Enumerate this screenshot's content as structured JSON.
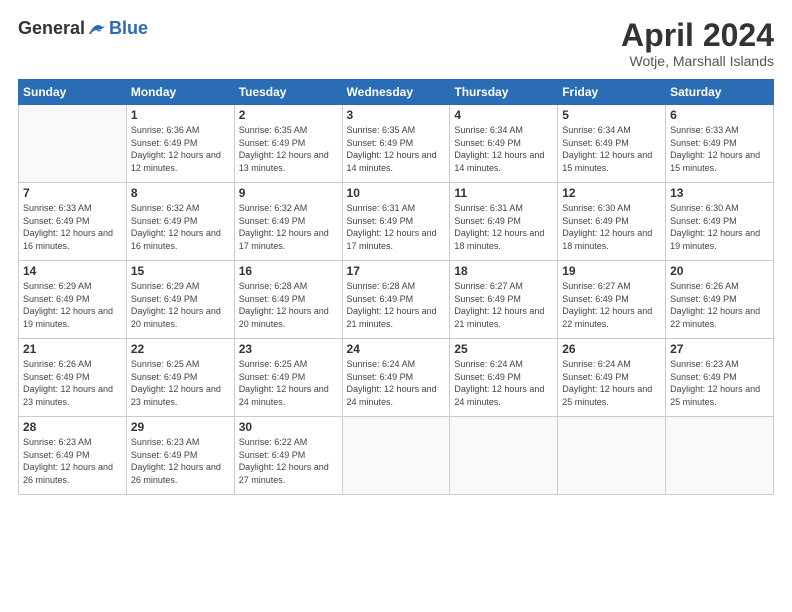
{
  "logo": {
    "general": "General",
    "blue": "Blue"
  },
  "title": "April 2024",
  "subtitle": "Wotje, Marshall Islands",
  "days_of_week": [
    "Sunday",
    "Monday",
    "Tuesday",
    "Wednesday",
    "Thursday",
    "Friday",
    "Saturday"
  ],
  "weeks": [
    [
      {
        "day": "",
        "sunrise": "",
        "sunset": "",
        "daylight": ""
      },
      {
        "day": "1",
        "sunrise": "Sunrise: 6:36 AM",
        "sunset": "Sunset: 6:49 PM",
        "daylight": "Daylight: 12 hours and 12 minutes."
      },
      {
        "day": "2",
        "sunrise": "Sunrise: 6:35 AM",
        "sunset": "Sunset: 6:49 PM",
        "daylight": "Daylight: 12 hours and 13 minutes."
      },
      {
        "day": "3",
        "sunrise": "Sunrise: 6:35 AM",
        "sunset": "Sunset: 6:49 PM",
        "daylight": "Daylight: 12 hours and 14 minutes."
      },
      {
        "day": "4",
        "sunrise": "Sunrise: 6:34 AM",
        "sunset": "Sunset: 6:49 PM",
        "daylight": "Daylight: 12 hours and 14 minutes."
      },
      {
        "day": "5",
        "sunrise": "Sunrise: 6:34 AM",
        "sunset": "Sunset: 6:49 PM",
        "daylight": "Daylight: 12 hours and 15 minutes."
      },
      {
        "day": "6",
        "sunrise": "Sunrise: 6:33 AM",
        "sunset": "Sunset: 6:49 PM",
        "daylight": "Daylight: 12 hours and 15 minutes."
      }
    ],
    [
      {
        "day": "7",
        "sunrise": "Sunrise: 6:33 AM",
        "sunset": "Sunset: 6:49 PM",
        "daylight": "Daylight: 12 hours and 16 minutes."
      },
      {
        "day": "8",
        "sunrise": "Sunrise: 6:32 AM",
        "sunset": "Sunset: 6:49 PM",
        "daylight": "Daylight: 12 hours and 16 minutes."
      },
      {
        "day": "9",
        "sunrise": "Sunrise: 6:32 AM",
        "sunset": "Sunset: 6:49 PM",
        "daylight": "Daylight: 12 hours and 17 minutes."
      },
      {
        "day": "10",
        "sunrise": "Sunrise: 6:31 AM",
        "sunset": "Sunset: 6:49 PM",
        "daylight": "Daylight: 12 hours and 17 minutes."
      },
      {
        "day": "11",
        "sunrise": "Sunrise: 6:31 AM",
        "sunset": "Sunset: 6:49 PM",
        "daylight": "Daylight: 12 hours and 18 minutes."
      },
      {
        "day": "12",
        "sunrise": "Sunrise: 6:30 AM",
        "sunset": "Sunset: 6:49 PM",
        "daylight": "Daylight: 12 hours and 18 minutes."
      },
      {
        "day": "13",
        "sunrise": "Sunrise: 6:30 AM",
        "sunset": "Sunset: 6:49 PM",
        "daylight": "Daylight: 12 hours and 19 minutes."
      }
    ],
    [
      {
        "day": "14",
        "sunrise": "Sunrise: 6:29 AM",
        "sunset": "Sunset: 6:49 PM",
        "daylight": "Daylight: 12 hours and 19 minutes."
      },
      {
        "day": "15",
        "sunrise": "Sunrise: 6:29 AM",
        "sunset": "Sunset: 6:49 PM",
        "daylight": "Daylight: 12 hours and 20 minutes."
      },
      {
        "day": "16",
        "sunrise": "Sunrise: 6:28 AM",
        "sunset": "Sunset: 6:49 PM",
        "daylight": "Daylight: 12 hours and 20 minutes."
      },
      {
        "day": "17",
        "sunrise": "Sunrise: 6:28 AM",
        "sunset": "Sunset: 6:49 PM",
        "daylight": "Daylight: 12 hours and 21 minutes."
      },
      {
        "day": "18",
        "sunrise": "Sunrise: 6:27 AM",
        "sunset": "Sunset: 6:49 PM",
        "daylight": "Daylight: 12 hours and 21 minutes."
      },
      {
        "day": "19",
        "sunrise": "Sunrise: 6:27 AM",
        "sunset": "Sunset: 6:49 PM",
        "daylight": "Daylight: 12 hours and 22 minutes."
      },
      {
        "day": "20",
        "sunrise": "Sunrise: 6:26 AM",
        "sunset": "Sunset: 6:49 PM",
        "daylight": "Daylight: 12 hours and 22 minutes."
      }
    ],
    [
      {
        "day": "21",
        "sunrise": "Sunrise: 6:26 AM",
        "sunset": "Sunset: 6:49 PM",
        "daylight": "Daylight: 12 hours and 23 minutes."
      },
      {
        "day": "22",
        "sunrise": "Sunrise: 6:25 AM",
        "sunset": "Sunset: 6:49 PM",
        "daylight": "Daylight: 12 hours and 23 minutes."
      },
      {
        "day": "23",
        "sunrise": "Sunrise: 6:25 AM",
        "sunset": "Sunset: 6:49 PM",
        "daylight": "Daylight: 12 hours and 24 minutes."
      },
      {
        "day": "24",
        "sunrise": "Sunrise: 6:24 AM",
        "sunset": "Sunset: 6:49 PM",
        "daylight": "Daylight: 12 hours and 24 minutes."
      },
      {
        "day": "25",
        "sunrise": "Sunrise: 6:24 AM",
        "sunset": "Sunset: 6:49 PM",
        "daylight": "Daylight: 12 hours and 24 minutes."
      },
      {
        "day": "26",
        "sunrise": "Sunrise: 6:24 AM",
        "sunset": "Sunset: 6:49 PM",
        "daylight": "Daylight: 12 hours and 25 minutes."
      },
      {
        "day": "27",
        "sunrise": "Sunrise: 6:23 AM",
        "sunset": "Sunset: 6:49 PM",
        "daylight": "Daylight: 12 hours and 25 minutes."
      }
    ],
    [
      {
        "day": "28",
        "sunrise": "Sunrise: 6:23 AM",
        "sunset": "Sunset: 6:49 PM",
        "daylight": "Daylight: 12 hours and 26 minutes."
      },
      {
        "day": "29",
        "sunrise": "Sunrise: 6:23 AM",
        "sunset": "Sunset: 6:49 PM",
        "daylight": "Daylight: 12 hours and 26 minutes."
      },
      {
        "day": "30",
        "sunrise": "Sunrise: 6:22 AM",
        "sunset": "Sunset: 6:49 PM",
        "daylight": "Daylight: 12 hours and 27 minutes."
      },
      {
        "day": "",
        "sunrise": "",
        "sunset": "",
        "daylight": ""
      },
      {
        "day": "",
        "sunrise": "",
        "sunset": "",
        "daylight": ""
      },
      {
        "day": "",
        "sunrise": "",
        "sunset": "",
        "daylight": ""
      },
      {
        "day": "",
        "sunrise": "",
        "sunset": "",
        "daylight": ""
      }
    ]
  ]
}
